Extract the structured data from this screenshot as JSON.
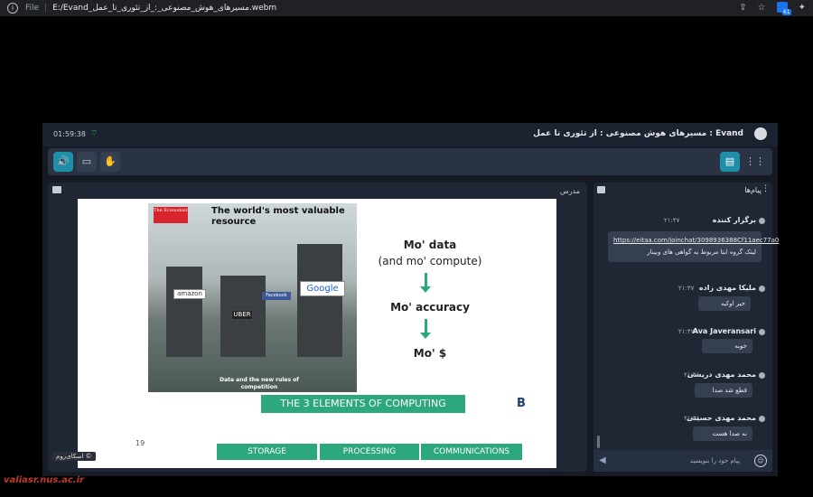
{
  "browser": {
    "file_label": "File",
    "url": "E:/Evand_مسیرهای_هوش_مصنوعی_:_از_تئوری_تا_عمل.webm",
    "extension_badge": "61"
  },
  "app": {
    "clock": "01:59:38",
    "title": "Evand : مسیرهای هوش مصنوعی : از تئوری تا عمل",
    "presenter_label": "مدرس",
    "skyroom_label": "اسکای‌روم ©"
  },
  "slide": {
    "magazine_logo": "The Economist",
    "magazine_headline": "The world's most valuable resource",
    "magazine_caption": "Data and the new rules of competition",
    "brands": [
      "amazon",
      "UBER",
      "Google",
      "Facebook"
    ],
    "mo_data": "Mo' data",
    "mo_compute": "(and mo' compute)",
    "mo_accuracy": "Mo' accuracy",
    "mo_money": "Mo' $",
    "banner": "THE 3 ELEMENTS OF COMPUTING",
    "page_number": "19",
    "tags": [
      "STORAGE",
      "PROCESSING",
      "COMMUNICATIONS"
    ],
    "logo": "B"
  },
  "chat": {
    "title": "پیام‌ها",
    "messages": [
      {
        "name": "برگزار کننده",
        "time": "۲۱:۴۷",
        "link": "https://eitaa.com/joinchat/3098936388Cf11aec77a0",
        "text": "لینک گروه ایتا مربوط به گواهی های وبینار"
      },
      {
        "name": "ملیکا مهدی زاده",
        "time": "۲۱:۴۷",
        "text": "خیر اوکیه"
      },
      {
        "name": "Ava Javeransari",
        "time": "۲۱:۴۷",
        "text": "خوبه"
      },
      {
        "name": "محمد مهدی دریسی",
        "time": "۲۱:۴۸",
        "text": "قطع شد صدا"
      },
      {
        "name": "محمد مهدی حسینی",
        "time": "۲۱:۴۸",
        "text": "نه صدا هست"
      }
    ],
    "placeholder": "پیام خود را بنویسید"
  },
  "watermark": "valiasr.nus.ac.ir",
  "colors": {
    "accent": "#1f8ea8",
    "slide_green": "#2ca87c",
    "panel": "#1f2634"
  }
}
